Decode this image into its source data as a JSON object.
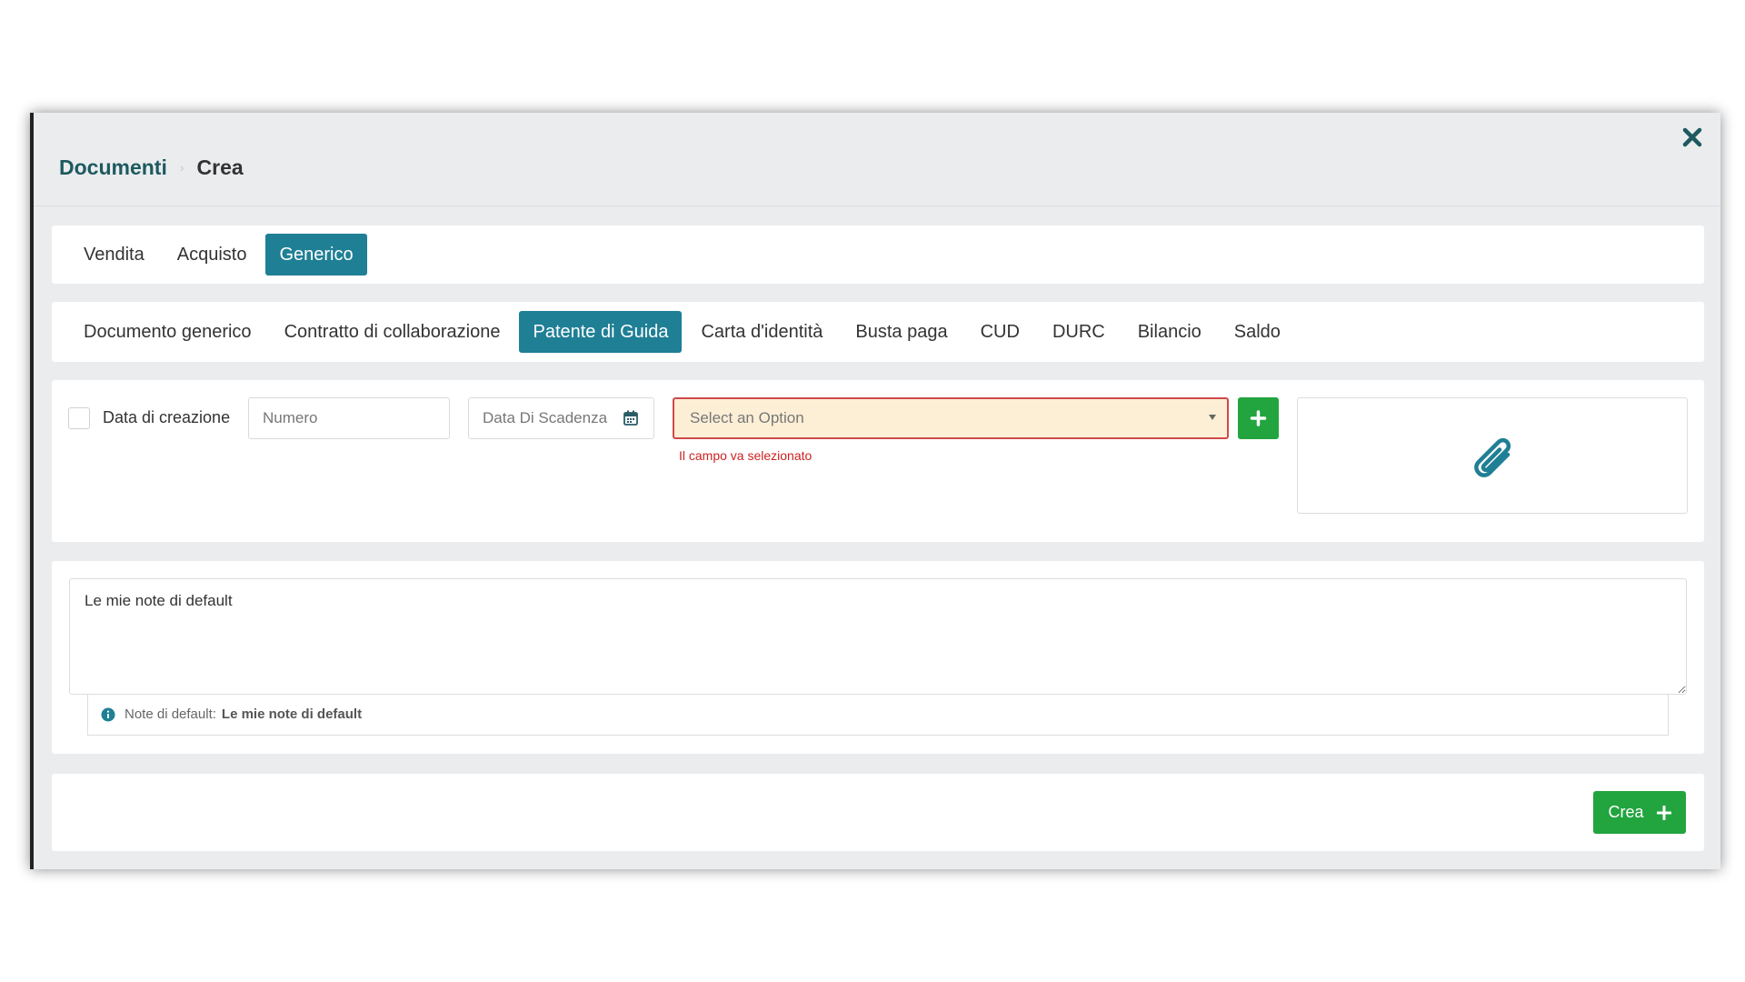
{
  "breadcrumb": {
    "root": "Documenti",
    "separator": "›",
    "current": "Crea"
  },
  "tabs": [
    {
      "label": "Vendita",
      "active": false
    },
    {
      "label": "Acquisto",
      "active": false
    },
    {
      "label": "Generico",
      "active": true
    }
  ],
  "subtabs": [
    {
      "label": "Documento generico",
      "active": false
    },
    {
      "label": "Contratto di collaborazione",
      "active": false
    },
    {
      "label": "Patente di Guida",
      "active": true
    },
    {
      "label": "Carta d'identità",
      "active": false
    },
    {
      "label": "Busta paga",
      "active": false
    },
    {
      "label": "CUD",
      "active": false
    },
    {
      "label": "DURC",
      "active": false
    },
    {
      "label": "Bilancio",
      "active": false
    },
    {
      "label": "Saldo",
      "active": false
    }
  ],
  "form": {
    "checkbox_label": "Data di creazione",
    "checkbox_checked": false,
    "numero_placeholder": "Numero",
    "scadenza_placeholder": "Data Di Scadenza",
    "select_placeholder": "Select an Option",
    "select_error": "Il campo va selezionato",
    "attach_icon": "paperclip-icon"
  },
  "notes": {
    "value": "Le mie note di default",
    "hint_label": "Note di default:",
    "hint_value": "Le mie note di default"
  },
  "footer": {
    "submit_label": "Crea"
  },
  "colors": {
    "brand": "#1f7f95",
    "breadcrumb": "#1d5a60",
    "success": "#22a43f",
    "error": "#cc2222",
    "select_bg": "#fcefd6",
    "modal_bg": "#ebecee"
  }
}
